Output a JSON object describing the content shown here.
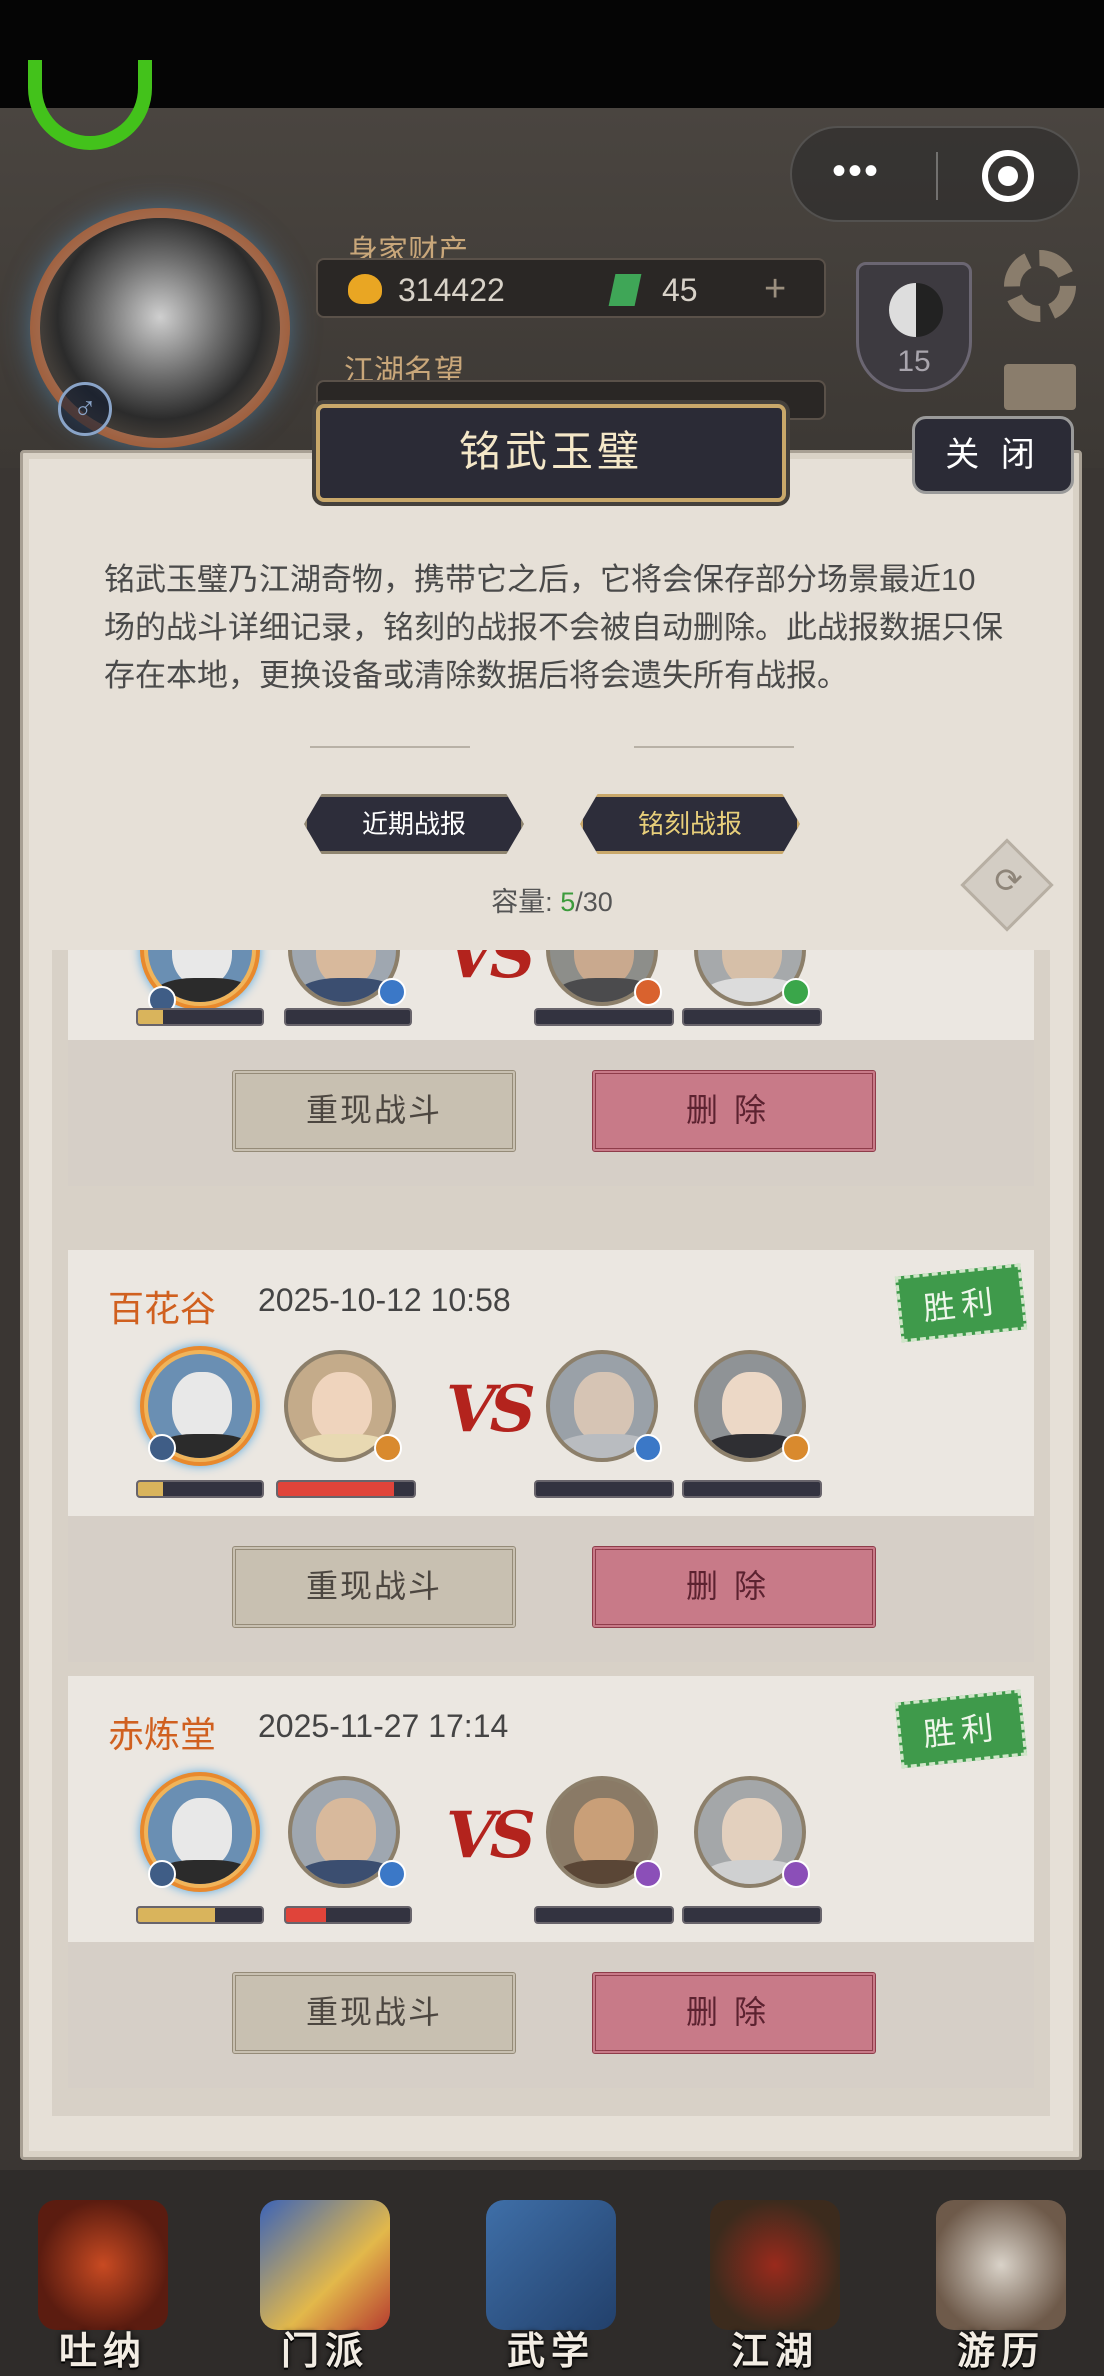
{
  "header": {
    "wealth_label": "身家财产",
    "coins": "314422",
    "jade": "45",
    "plus": "+",
    "fame_label": "江湖名望",
    "taiji_level": "15",
    "gender_symbol": "♂"
  },
  "modal": {
    "title": "铭武玉璧",
    "close_label": "关 闭",
    "description": "铭武玉璧乃江湖奇物，携带它之后，它将会保存部分场景最近10场的战斗详细记录，铭刻的战报不会被自动删除。此战报数据只保存在本地，更换设备或清除数据后将会遗失所有战报。",
    "tabs": [
      {
        "label": "近期战报",
        "active": false
      },
      {
        "label": "铭刻战报",
        "active": true
      }
    ],
    "capacity_label": "容量:",
    "capacity_used": "5",
    "capacity_total": "/30"
  },
  "records": [
    {
      "school": "",
      "date": "",
      "result": "",
      "ally_hp": [
        0.2,
        0
      ],
      "enemy_hp": [
        0,
        0
      ],
      "replay_label": "重现战斗",
      "delete_label": "删除"
    },
    {
      "school": "百花谷",
      "date": "2025-10-12 10:58",
      "result": "胜利",
      "ally_hp": [
        0.2,
        0.85
      ],
      "enemy_hp": [
        0,
        0
      ],
      "replay_label": "重现战斗",
      "delete_label": "删除"
    },
    {
      "school": "赤炼堂",
      "date": "2025-11-27 17:14",
      "result": "胜利",
      "ally_hp": [
        0.62,
        0.32
      ],
      "enemy_hp": [
        0,
        0
      ],
      "replay_label": "重现战斗",
      "delete_label": "删除"
    }
  ],
  "vs_text": "VS",
  "nav": [
    {
      "label": "吐纳",
      "icon": "meditation-icon"
    },
    {
      "label": "门派",
      "icon": "sect-icon"
    },
    {
      "label": "武学",
      "icon": "martial-arts-icon"
    },
    {
      "label": "江湖",
      "icon": "jianghu-icon"
    },
    {
      "label": "游历",
      "icon": "travel-icon"
    }
  ],
  "colors": {
    "ally_hp_gold": "#d9b45c",
    "ally_hp_red": "#e0443a",
    "school_text": "#d0601f",
    "victory_green": "#3f9a4b"
  }
}
